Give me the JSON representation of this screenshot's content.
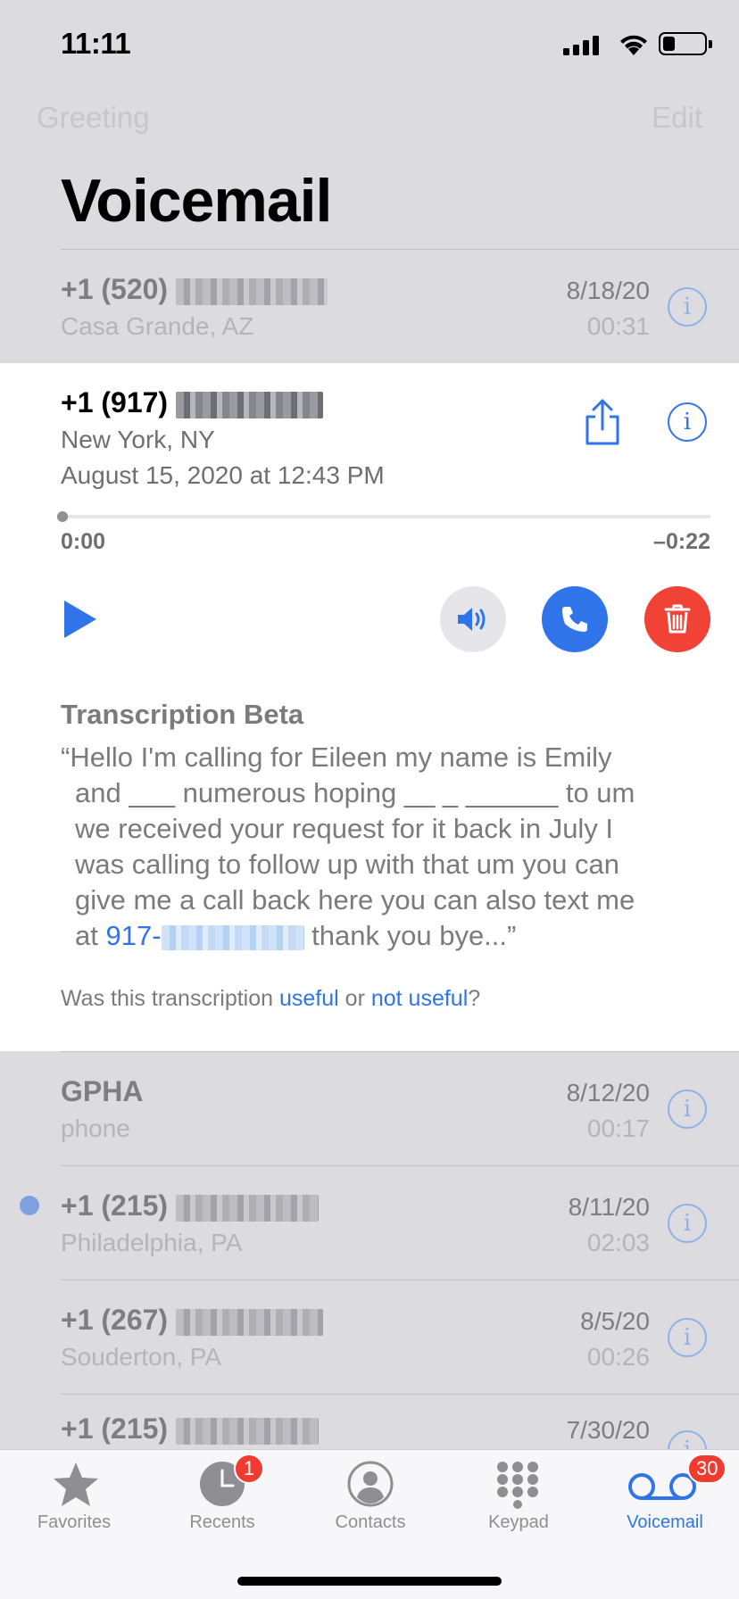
{
  "status_bar": {
    "time": "11:11"
  },
  "nav": {
    "left_label": "Greeting",
    "right_label": "Edit",
    "title": "Voicemail"
  },
  "voicemails": [
    {
      "name": "+1 (520)",
      "location": "Casa Grande, AZ",
      "date": "8/18/20",
      "duration": "00:31"
    },
    {
      "name": "GPHA",
      "location": "phone",
      "date": "8/12/20",
      "duration": "00:17"
    },
    {
      "name": "+1 (215)",
      "location": "Philadelphia, PA",
      "date": "8/11/20",
      "duration": "02:03",
      "unread": true
    },
    {
      "name": "+1 (267)",
      "location": "Souderton, PA",
      "date": "8/5/20",
      "duration": "00:26"
    },
    {
      "name": "+1 (215)",
      "location": "",
      "date": "7/30/20",
      "duration": ""
    }
  ],
  "expanded": {
    "name": "+1 (917)",
    "location": "New York, NY",
    "datetime": "August 15, 2020 at 12:43 PM",
    "elapsed": "0:00",
    "remaining": "–0:22",
    "progress": 0.0
  },
  "transcription": {
    "title": "Transcription Beta",
    "line1": "“Hello I'm calling for Eileen my name is Emily",
    "line2": "and ___ numerous hoping __ _ ______ to um",
    "line3": "we received your request for it back in July I",
    "line4": "was calling to follow up with that um you can",
    "line5": "give me a call back here you can also text me",
    "line6_prefix": "at",
    "phone_prefix": "917-",
    "line6_suffix": "thank you bye...”",
    "feedback_prefix": "Was this transcription",
    "useful": "useful",
    "or": "or",
    "not_useful": "not useful",
    "feedback_suffix": "?"
  },
  "tabs": [
    {
      "label": "Favorites",
      "icon": "star-icon"
    },
    {
      "label": "Recents",
      "icon": "clock-icon",
      "badge": "1"
    },
    {
      "label": "Contacts",
      "icon": "person-circle-icon"
    },
    {
      "label": "Keypad",
      "icon": "keypad-icon"
    },
    {
      "label": "Voicemail",
      "icon": "voicemail-icon",
      "badge": "30",
      "active": true
    }
  ],
  "colors": {
    "accent": "#2f74e8",
    "delete": "#f04336",
    "badge": "#f13b30",
    "dimmed_bg": "#dcdce0"
  }
}
